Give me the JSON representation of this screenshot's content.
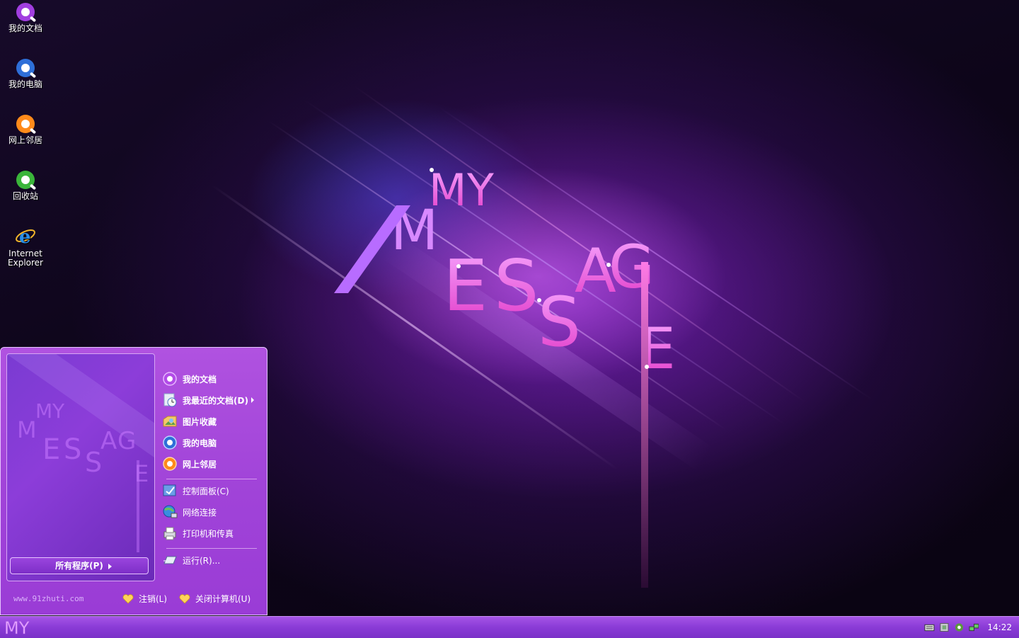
{
  "desktop": {
    "icons": [
      {
        "label": "我的文档",
        "icon": "quicktime-purple-icon",
        "color": "#a13ee0"
      },
      {
        "label": "我的电脑",
        "icon": "quicktime-blue-icon",
        "color": "#2e6fd8"
      },
      {
        "label": "网上邻居",
        "icon": "quicktime-orange-icon",
        "color": "#ff8a1a"
      },
      {
        "label": "回收站",
        "icon": "quicktime-green-icon",
        "color": "#3ab53a"
      },
      {
        "label": "Internet Explorer",
        "icon": "internet-explorer-icon",
        "color": "#2a8ee6"
      }
    ],
    "wallpaper_letters": [
      "M",
      "Y",
      "M",
      "E",
      "S",
      "S",
      "A",
      "G",
      "E"
    ]
  },
  "start_menu": {
    "all_programs_label": "所有程序(P)",
    "website": "www.91zhuti.com",
    "items_top": [
      {
        "label": "我的文档",
        "icon": "my-documents-icon"
      },
      {
        "label": "我最近的文档(D)",
        "icon": "recent-documents-icon"
      },
      {
        "label": "图片收藏",
        "icon": "my-pictures-icon"
      },
      {
        "label": "我的电脑",
        "icon": "my-computer-icon"
      },
      {
        "label": "网上邻居",
        "icon": "network-places-icon"
      }
    ],
    "items_mid": [
      {
        "label": "控制面板(C)",
        "icon": "control-panel-icon"
      },
      {
        "label": "网络连接",
        "icon": "network-connections-icon"
      },
      {
        "label": "打印机和传真",
        "icon": "printers-icon"
      }
    ],
    "run_label": "运行(R)...",
    "logoff_label": "注销(L)",
    "shutdown_label": "关闭计算机(U)"
  },
  "taskbar": {
    "start_label": "MY",
    "clock": "14:22",
    "tray_icons": [
      "keyboard-icon",
      "security-icon",
      "quicktime-tray-icon",
      "network-tray-icon"
    ]
  },
  "colors": {
    "accent": "#a043d8",
    "taskbar": "#8a3bd6",
    "heart": "#ffd35a"
  }
}
